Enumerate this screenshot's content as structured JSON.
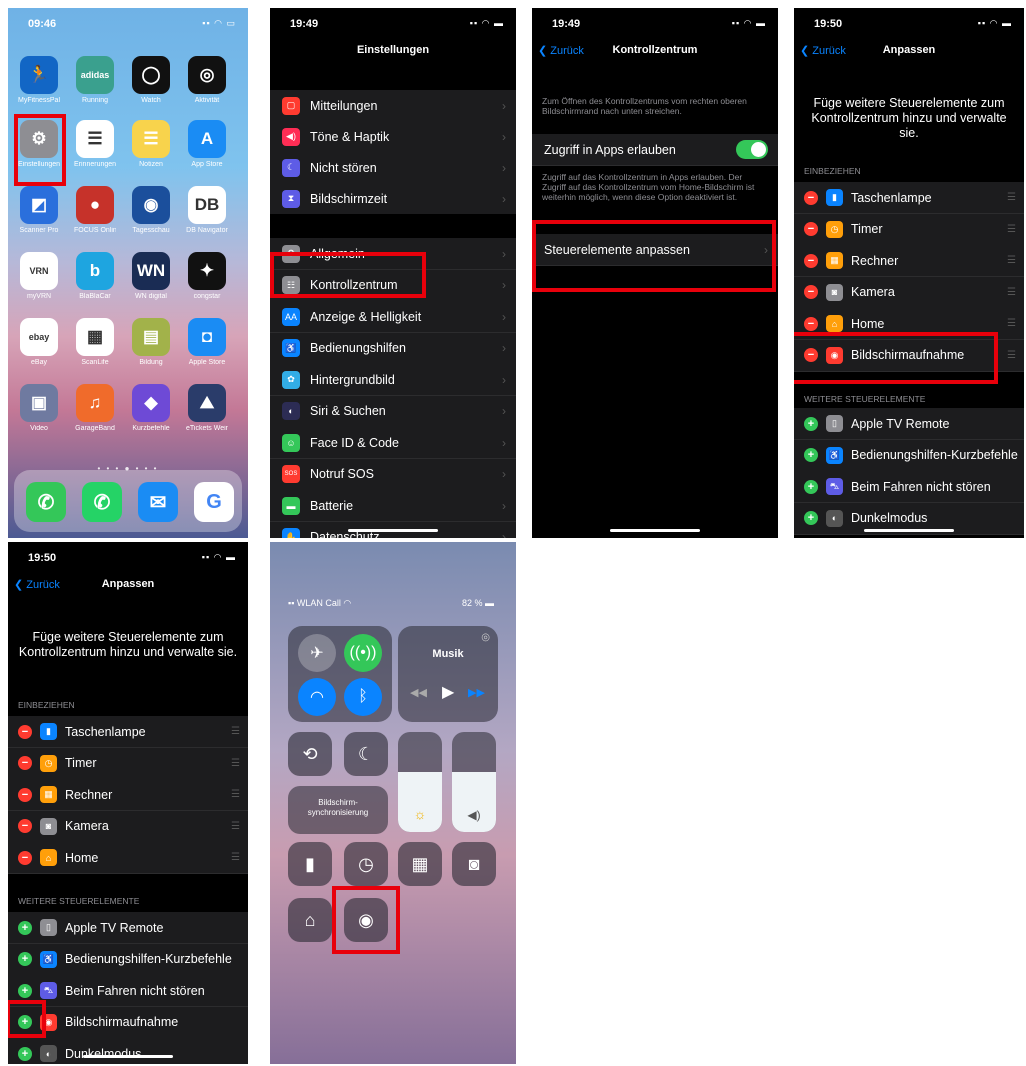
{
  "colors": {
    "accent": "#0a84ff",
    "highlight": "#e8000b",
    "toggle_on": "#34c759",
    "minus": "#ff3b30",
    "plus": "#34c759"
  },
  "p1": {
    "time": "09:46",
    "apps": [
      {
        "label": "MyFitnessPal",
        "icon": "figure-icon",
        "glyph": "🏃",
        "color": "#1266c5"
      },
      {
        "label": "Running",
        "icon": "adidas-icon",
        "glyph": "adidas",
        "color": "#3aa08e"
      },
      {
        "label": "Watch",
        "icon": "watch-icon",
        "glyph": "◯",
        "color": "#111111"
      },
      {
        "label": "Aktivität",
        "icon": "activity-rings-icon",
        "glyph": "◎",
        "color": "#111111"
      },
      {
        "label": "Einstellungen",
        "icon": "gear-icon",
        "glyph": "⚙",
        "color": "#8e8e93"
      },
      {
        "label": "Erinnerungen",
        "icon": "reminders-icon",
        "glyph": "☰",
        "color": "#ffffff"
      },
      {
        "label": "Notizen",
        "icon": "notes-icon",
        "glyph": "☰",
        "color": "#f8d34c"
      },
      {
        "label": "App Store",
        "icon": "app-store-icon",
        "glyph": "A",
        "color": "#1a8cf4"
      },
      {
        "label": "Scanner Pro",
        "icon": "scanner-icon",
        "glyph": "◩",
        "color": "#2a6fdc"
      },
      {
        "label": "FOCUS Online",
        "icon": "globe-icon",
        "glyph": "●",
        "color": "#c6322a"
      },
      {
        "label": "Tagesschau",
        "icon": "tagesschau-icon",
        "glyph": "◉",
        "color": "#1b4f9c"
      },
      {
        "label": "DB Navigator",
        "icon": "db-icon",
        "glyph": "DB",
        "color": "#ffffff"
      },
      {
        "label": "myVRN",
        "icon": "vrn-icon",
        "glyph": "VRN",
        "color": "#ffffff"
      },
      {
        "label": "BlaBlaCar",
        "icon": "blablacar-icon",
        "glyph": "b",
        "color": "#1ea5e0"
      },
      {
        "label": "WN digital",
        "icon": "wn-icon",
        "glyph": "WN",
        "color": "#1a2c54"
      },
      {
        "label": "congstar",
        "icon": "congstar-icon",
        "glyph": "✦",
        "color": "#111111"
      },
      {
        "label": "eBay",
        "icon": "ebay-icon",
        "glyph": "ebay",
        "color": "#ffffff"
      },
      {
        "label": "ScanLife",
        "icon": "qr-icon",
        "glyph": "▦",
        "color": "#ffffff"
      },
      {
        "label": "Bildung",
        "icon": "folder-icon",
        "glyph": "▤",
        "color": "#a2b24a"
      },
      {
        "label": "Apple Store",
        "icon": "apple-store-icon",
        "glyph": "◘",
        "color": "#1a8cf4"
      },
      {
        "label": "Video",
        "icon": "video-folder-icon",
        "glyph": "▣",
        "color": "#6f7aa0"
      },
      {
        "label": "GarageBand",
        "icon": "guitar-icon",
        "glyph": "♫",
        "color": "#f06b2b"
      },
      {
        "label": "Kurzbefehle",
        "icon": "shortcuts-icon",
        "glyph": "◆",
        "color": "#6e4ad6"
      },
      {
        "label": "eTickets Weinh...",
        "icon": "mountain-icon",
        "glyph": "⛰",
        "color": "#2a3c6a"
      }
    ],
    "dock": [
      {
        "icon": "phone-icon",
        "glyph": "✆",
        "color": "#34c759"
      },
      {
        "icon": "whatsapp-icon",
        "glyph": "✆",
        "color": "#25d366"
      },
      {
        "icon": "mail-icon",
        "glyph": "✉",
        "color": "#1a8cf4"
      },
      {
        "icon": "google-icon",
        "glyph": "G",
        "color": "#ffffff"
      }
    ]
  },
  "p2": {
    "time": "19:49",
    "title": "Einstellungen",
    "group1": [
      {
        "label": "Mitteilungen",
        "icon": "notifications-icon",
        "glyph": "▢",
        "color": "#ff3b30"
      },
      {
        "label": "Töne & Haptik",
        "icon": "sound-icon",
        "glyph": "◀)",
        "color": "#ff2d55"
      },
      {
        "label": "Nicht stören",
        "icon": "moon-icon",
        "glyph": "☾",
        "color": "#5e5ce6"
      },
      {
        "label": "Bildschirmzeit",
        "icon": "hourglass-icon",
        "glyph": "⧗",
        "color": "#5e5ce6"
      }
    ],
    "group2": [
      {
        "label": "Allgemein",
        "icon": "gear-icon",
        "glyph": "⚙",
        "color": "#8e8e93"
      },
      {
        "label": "Kontrollzentrum",
        "icon": "control-center-icon",
        "glyph": "☷",
        "color": "#8e8e93"
      },
      {
        "label": "Anzeige & Helligkeit",
        "icon": "display-icon",
        "glyph": "AA",
        "color": "#0a84ff"
      },
      {
        "label": "Bedienungshilfen",
        "icon": "accessibility-icon",
        "glyph": "♿",
        "color": "#0a84ff"
      },
      {
        "label": "Hintergrundbild",
        "icon": "wallpaper-icon",
        "glyph": "✿",
        "color": "#32ade6"
      },
      {
        "label": "Siri & Suchen",
        "icon": "siri-icon",
        "glyph": "◐",
        "color": "#2c2c54"
      },
      {
        "label": "Face ID & Code",
        "icon": "face-id-icon",
        "glyph": "☺",
        "color": "#34c759"
      },
      {
        "label": "Notruf SOS",
        "icon": "sos-icon",
        "glyph": "SOS",
        "color": "#ff3b30"
      },
      {
        "label": "Batterie",
        "icon": "battery-icon",
        "glyph": "▬",
        "color": "#34c759"
      },
      {
        "label": "Datenschutz",
        "icon": "hand-icon",
        "glyph": "✋",
        "color": "#0a84ff"
      }
    ]
  },
  "p3": {
    "time": "19:49",
    "back": "Zurück",
    "title": "Kontrollzentrum",
    "note1": "Zum Öffnen des Kontrollzentrums vom rechten oberen Bildschirmrand nach unten streichen.",
    "toggle_label": "Zugriff in Apps erlauben",
    "note2": "Zugriff auf das Kontrollzentrum in Apps erlauben. Der Zugriff auf das Kontrollzentrum vom Home-Bildschirm ist weiterhin möglich, wenn diese Option deaktiviert ist.",
    "customize": "Steuerelemente anpassen"
  },
  "p4": {
    "time": "19:50",
    "back": "Zurück",
    "title": "Anpassen",
    "intro": "Füge weitere Steuerelemente zum Kontrollzentrum hinzu und verwalte sie.",
    "include_header": "EINBEZIEHEN",
    "include": [
      {
        "label": "Taschenlampe",
        "icon": "flashlight-icon",
        "glyph": "▮",
        "color": "#0a84ff"
      },
      {
        "label": "Timer",
        "icon": "timer-icon",
        "glyph": "◷",
        "color": "#ff9f0a"
      },
      {
        "label": "Rechner",
        "icon": "calculator-icon",
        "glyph": "▦",
        "color": "#ff9f0a"
      },
      {
        "label": "Kamera",
        "icon": "camera-icon",
        "glyph": "◙",
        "color": "#8e8e93"
      },
      {
        "label": "Home",
        "icon": "home-icon",
        "glyph": "⌂",
        "color": "#ff9f0a"
      },
      {
        "label": "Bildschirmaufnahme",
        "icon": "screen-record-icon",
        "glyph": "◉",
        "color": "#ff3b30"
      }
    ],
    "more_header": "WEITERE STEUERELEMENTE",
    "more": [
      {
        "label": "Apple TV Remote",
        "icon": "remote-icon",
        "glyph": "▯",
        "color": "#8e8e93"
      },
      {
        "label": "Bedienungshilfen-Kurzbefehle",
        "icon": "accessibility-icon",
        "glyph": "♿",
        "color": "#0a84ff"
      },
      {
        "label": "Beim Fahren nicht stören",
        "icon": "car-icon",
        "glyph": "⛍",
        "color": "#5e5ce6"
      },
      {
        "label": "Dunkelmodus",
        "icon": "dark-mode-icon",
        "glyph": "◐",
        "color": "#555555"
      }
    ]
  },
  "p5": {
    "time": "19:50",
    "back": "Zurück",
    "title": "Anpassen",
    "intro": "Füge weitere Steuerelemente zum Kontrollzentrum hinzu und verwalte sie.",
    "include_header": "EINBEZIEHEN",
    "include": [
      {
        "label": "Taschenlampe",
        "icon": "flashlight-icon",
        "glyph": "▮",
        "color": "#0a84ff"
      },
      {
        "label": "Timer",
        "icon": "timer-icon",
        "glyph": "◷",
        "color": "#ff9f0a"
      },
      {
        "label": "Rechner",
        "icon": "calculator-icon",
        "glyph": "▦",
        "color": "#ff9f0a"
      },
      {
        "label": "Kamera",
        "icon": "camera-icon",
        "glyph": "◙",
        "color": "#8e8e93"
      },
      {
        "label": "Home",
        "icon": "home-icon",
        "glyph": "⌂",
        "color": "#ff9f0a"
      }
    ],
    "more_header": "WEITERE STEUERELEMENTE",
    "more": [
      {
        "label": "Apple TV Remote",
        "icon": "remote-icon",
        "glyph": "▯",
        "color": "#8e8e93"
      },
      {
        "label": "Bedienungshilfen-Kurzbefehle",
        "icon": "accessibility-icon",
        "glyph": "♿",
        "color": "#0a84ff"
      },
      {
        "label": "Beim Fahren nicht stören",
        "icon": "car-icon",
        "glyph": "⛍",
        "color": "#5e5ce6"
      },
      {
        "label": "Bildschirmaufnahme",
        "icon": "screen-record-icon",
        "glyph": "◉",
        "color": "#ff3b30"
      },
      {
        "label": "Dunkelmodus",
        "icon": "dark-mode-icon",
        "glyph": "◐",
        "color": "#555555"
      }
    ]
  },
  "p6": {
    "carrier": "WLAN Call",
    "battery": "82 %",
    "music": "Musik",
    "mirror": "Bildschirm-synchronisierung"
  }
}
